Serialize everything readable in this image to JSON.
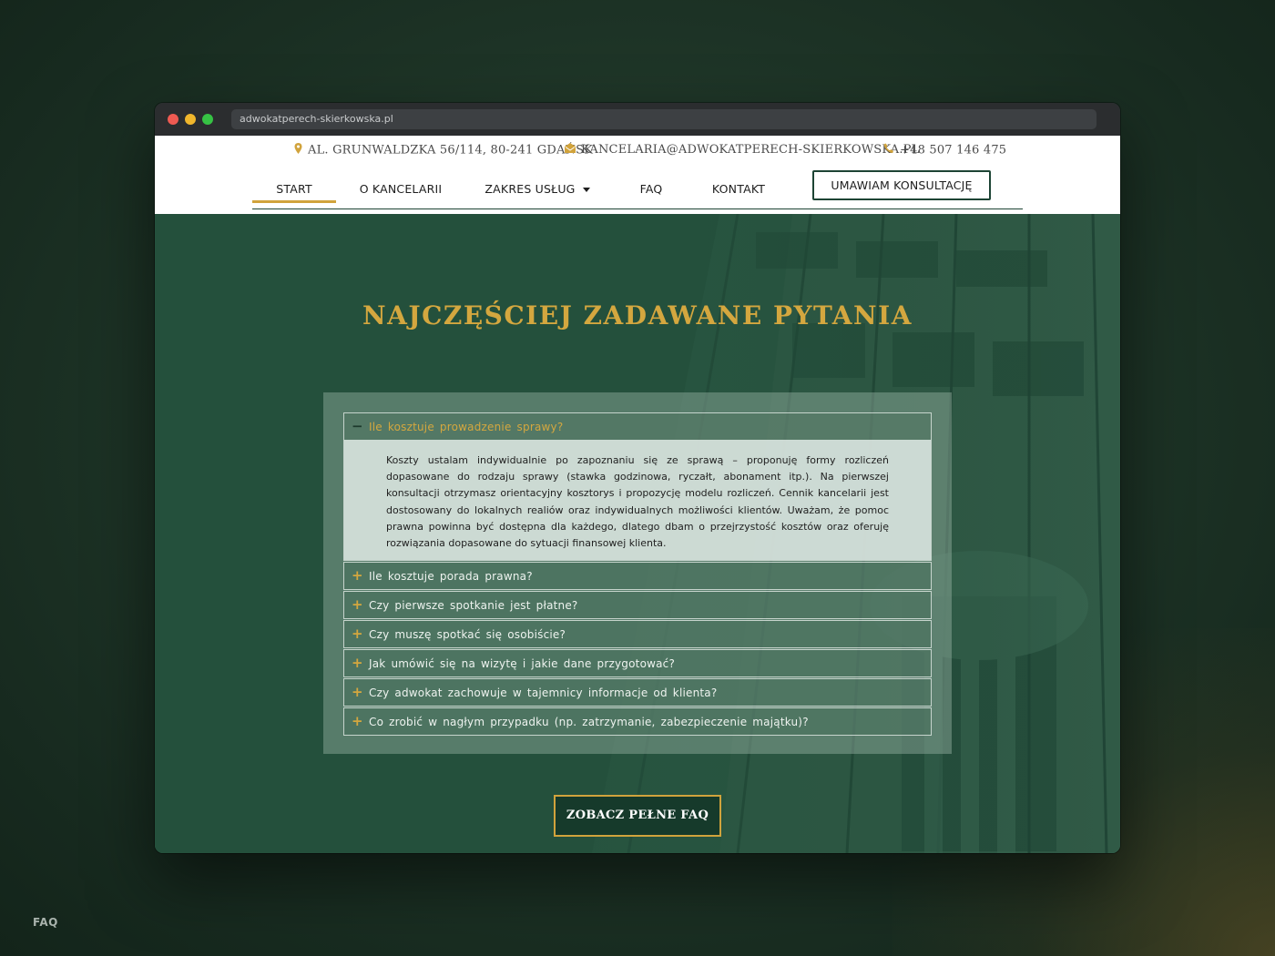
{
  "browser": {
    "url": "adwokatperech-skierkowska.pl"
  },
  "topbar": {
    "address": "AL. GRUNWALDZKA 56/114, 80-241 GDAŃSK",
    "email": "KANCELARIA@ADWOKATPERECH-SKIERKOWSKA.PL",
    "phone": "+48 507 146 475"
  },
  "nav": {
    "items": [
      {
        "label": "START",
        "active": true
      },
      {
        "label": "O KANCELARII"
      },
      {
        "label": "ZAKRES USŁUG"
      },
      {
        "label": "FAQ"
      },
      {
        "label": "KONTAKT"
      }
    ],
    "cta": "UMAWIAM KONSULTACJĘ"
  },
  "faq": {
    "title": "NAJCZĘŚCIEJ ZADAWANE PYTANIA",
    "items": [
      {
        "question": "Ile kosztuje prowadzenie sprawy?",
        "open": true,
        "answer": "Koszty ustalam indywidualnie po zapoznaniu się ze sprawą – proponuję formy rozliczeń dopasowane do rodzaju sprawy (stawka godzinowa, ryczałt, abonament itp.). Na pierwszej konsultacji otrzymasz orientacyjny kosztorys i propozycję modelu rozliczeń. Cennik kancelarii jest dostosowany do lokalnych realiów oraz indywidualnych możliwości klientów. Uważam, że pomoc prawna powinna być dostępna dla każdego, dlatego dbam o przejrzystość kosztów oraz oferuję rozwiązania dopasowane do sytuacji finansowej klienta."
      },
      {
        "question": "Ile kosztuje porada prawna?"
      },
      {
        "question": "Czy pierwsze spotkanie jest płatne?"
      },
      {
        "question": "Czy muszę spotkać się osobiście?"
      },
      {
        "question": "Jak umówić się na wizytę i jakie dane przygotować?"
      },
      {
        "question": "Czy adwokat zachowuje w tajemnicy informacje od klienta?"
      },
      {
        "question": "Co zrobić w nagłym przypadku (np. zatrzymanie, zabezpieczenie majątku)?"
      }
    ],
    "open_sign": "−",
    "closed_sign": "+",
    "button": "ZOBACZ PEŁNE FAQ"
  },
  "caption": "FAQ",
  "colors": {
    "accent_gold": "#d4a73f",
    "brand_green": "#1d4434",
    "hero_green": "#24503c"
  }
}
